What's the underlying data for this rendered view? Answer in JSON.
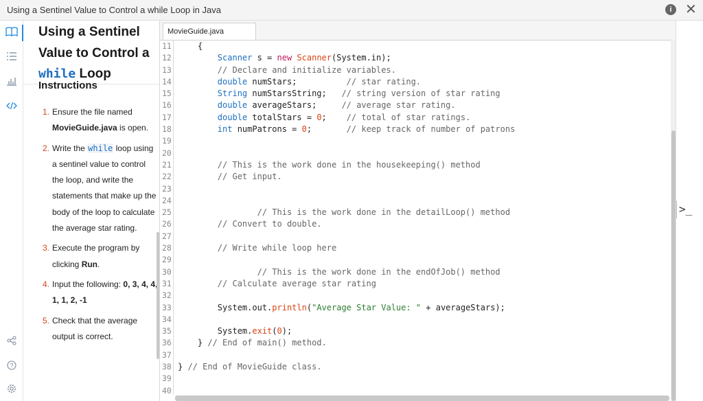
{
  "window": {
    "title": "Using a Sentinel Value to Control a while Loop in Java",
    "info_label": "i",
    "close_label": "✕"
  },
  "rail": {
    "icons": [
      "book-icon",
      "list-icon",
      "chart-icon",
      "code-icon",
      "share-icon",
      "help-icon",
      "settings-icon"
    ]
  },
  "panel": {
    "heading_a": "Using a Sentinel Value to Control a",
    "heading_code": "while",
    "heading_b": "Loop",
    "subheading": "Instructions",
    "steps": [
      {
        "num": "1.",
        "a": "Ensure the file named ",
        "b": "MovieGuide.java",
        "c": " is open."
      },
      {
        "num": "2.",
        "a": "Write the ",
        "code": "while",
        "c": " loop using a sentinel value to control the loop, and write the statements that make up the body of the loop to calculate the average star rating."
      },
      {
        "num": "3.",
        "a": "Execute the program by clicking ",
        "b": "Run",
        "c": "."
      },
      {
        "num": "4.",
        "a": "Input the following: ",
        "b": "0, 3, 4, 4, 1, 1, 2, -1",
        "c": ""
      },
      {
        "num": "5.",
        "a": "Check that the average output is correct.",
        "c": ""
      }
    ]
  },
  "editor": {
    "tab_label": "MovieGuide.java",
    "line_numbers": [
      "11",
      "12",
      "13",
      "14",
      "15",
      "16",
      "17",
      "18",
      "19",
      "20",
      "21",
      "22",
      "23",
      "24",
      "25",
      "26",
      "27",
      "28",
      "29",
      "30",
      "31",
      "32",
      "33",
      "34",
      "35",
      "36",
      "37",
      "38",
      "39",
      "40"
    ]
  },
  "code": {
    "l11": "    {",
    "l12_kw": "Scanner",
    "l12_a": " s = ",
    "l12_new": "new",
    "l12_b": " ",
    "l12_c": "Scanner",
    "l12_d": "(System.in);",
    "l13": "        // Declare and initialize variables.",
    "l14_kw": "double",
    "l14_a": " numStars;          ",
    "l14_cm": "// star rating.",
    "l15_kw": "String",
    "l15_a": " numStarsString;   ",
    "l15_cm": "// string version of star rating",
    "l16_kw": "double",
    "l16_a": " averageStars;     ",
    "l16_cm": "// average star rating.",
    "l17_kw": "double",
    "l17_a": " totalStars = ",
    "l17_num": "0",
    "l17_b": ";    ",
    "l17_cm": "// total of star ratings.",
    "l18_kw": "int",
    "l18_a": " numPatrons = ",
    "l18_num": "0",
    "l18_b": ";       ",
    "l18_cm": "// keep track of number of patrons",
    "l21": "        // This is the work done in the housekeeping() method",
    "l22": "        // Get input.",
    "l25": "                // This is the work done in the detailLoop() method",
    "l26": "        // Convert to double.",
    "l28": "        // Write while loop here",
    "l30": "                // This is the work done in the endOfJob() method",
    "l31": "        // Calculate average star rating",
    "l33_a": "System.out.",
    "l33_fn": "println",
    "l33_b": "(",
    "l33_str": "\"Average Star Value: \"",
    "l33_c": " + averageStars);",
    "l35_a": "System.",
    "l35_fn": "exit",
    "l35_b": "(",
    "l35_num": "0",
    "l35_c": ");",
    "l36_a": "    } ",
    "l36_cm": "// End of main() method.",
    "l38_a": "} ",
    "l38_cm": "// End of MovieGuide class."
  },
  "right_rail": {
    "terminal_label": ">_"
  }
}
